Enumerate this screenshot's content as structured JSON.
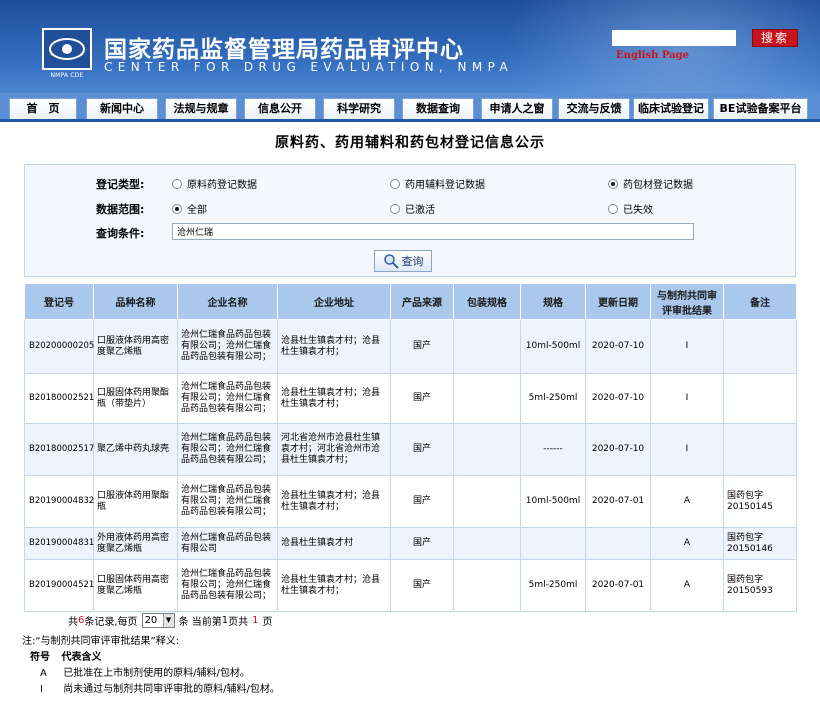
{
  "header": {
    "logo_caption": "NMPA CDE",
    "title_cn": "国家药品监督管理局药品审评中心",
    "title_en": "CENTER FOR DRUG EVALUATION, NMPA",
    "search_value": "",
    "search_button": "搜索",
    "english_link": "English Page"
  },
  "nav": {
    "items": [
      {
        "label": "首　页"
      },
      {
        "label": "新闻中心"
      },
      {
        "label": "法规与规章"
      },
      {
        "label": "信息公开"
      },
      {
        "label": "科学研究"
      },
      {
        "label": "数据查询"
      },
      {
        "label": "申请人之窗"
      },
      {
        "label": "交流与反馈"
      },
      {
        "label": "临床试验登记"
      },
      {
        "label": "BE试验备案平台"
      }
    ]
  },
  "page": {
    "title": "原料药、药用辅料和药包材登记信息公示"
  },
  "form": {
    "type_label": "登记类型:",
    "type_options": [
      {
        "label": "原料药登记数据",
        "selected": false
      },
      {
        "label": "药用辅料登记数据",
        "selected": false
      },
      {
        "label": "药包材登记数据",
        "selected": true
      }
    ],
    "scope_label": "数据范围:",
    "scope_options": [
      {
        "label": "全部",
        "selected": true
      },
      {
        "label": "已激活",
        "selected": false
      },
      {
        "label": "已失效",
        "selected": false
      }
    ],
    "condition_label": "查询条件:",
    "condition_value": "沧州仁瑞",
    "query_button": "查询"
  },
  "table": {
    "headers": [
      "登记号",
      "品种名称",
      "企业名称",
      "企业地址",
      "产品来源",
      "包装规格",
      "规格",
      "更新日期",
      "与制剂共同审评审批结果",
      "备注"
    ],
    "rows": [
      {
        "reg": "B20200000205",
        "name": "口服液体药用高密度聚乙烯瓶",
        "company": "沧州仁瑞食品药品包装有限公司；沧州仁瑞食品药品包装有限公司；",
        "address": "沧县杜生镇袁才村；沧县杜生镇袁才村；",
        "source": "国产",
        "pack": "",
        "spec": "10ml-500ml",
        "date": "2020-07-10",
        "result": "I",
        "note": ""
      },
      {
        "reg": "B20180002521",
        "name": "口服固体药用聚酯瓶（带垫片）",
        "company": "沧州仁瑞食品药品包装有限公司；沧州仁瑞食品药品包装有限公司；",
        "address": "沧县杜生镇袁才村；沧县杜生镇袁才村；",
        "source": "国产",
        "pack": "",
        "spec": "5ml-250ml",
        "date": "2020-07-10",
        "result": "I",
        "note": ""
      },
      {
        "reg": "B20180002517",
        "name": "聚乙烯中药丸球壳",
        "company": "沧州仁瑞食品药品包装有限公司；沧州仁瑞食品药品包装有限公司；",
        "address": "河北省沧州市沧县杜生镇袁才村；河北省沧州市沧县杜生镇袁才村；",
        "source": "国产",
        "pack": "",
        "spec": "------",
        "date": "2020-07-10",
        "result": "I",
        "note": ""
      },
      {
        "reg": "B20190004832",
        "name": "口服液体药用聚酯瓶",
        "company": "沧州仁瑞食品药品包装有限公司；沧州仁瑞食品药品包装有限公司；",
        "address": "沧县杜生镇袁才村；沧县杜生镇袁才村；",
        "source": "国产",
        "pack": "",
        "spec": "10ml-500ml",
        "date": "2020-07-01",
        "result": "A",
        "note": "国药包字20150145"
      },
      {
        "reg": "B20190004831",
        "name": "外用液体药用高密度聚乙烯瓶",
        "company": "沧州仁瑞食品药品包装有限公司",
        "address": "沧县杜生镇袁才村",
        "source": "国产",
        "pack": "",
        "spec": "",
        "date": "",
        "result": "A",
        "note": "国药包字20150146"
      },
      {
        "reg": "B20190004521",
        "name": "口服固体药用高密度聚乙烯瓶",
        "company": "沧州仁瑞食品药品包装有限公司；沧州仁瑞食品药品包装有限公司；",
        "address": "沧县杜生镇袁才村；沧县杜生镇袁才村；",
        "source": "国产",
        "pack": "",
        "spec": "5ml-250ml",
        "date": "2020-07-01",
        "result": "A",
        "note": "国药包字20150593"
      }
    ]
  },
  "pager": {
    "prefix": "共",
    "total": "6",
    "mid1": "条记录,每页",
    "page_size": "20",
    "mid2": "条 当前第",
    "current": "1",
    "mid3": "页共",
    "pages": "1",
    "suffix": "页"
  },
  "notes": {
    "intro": "注:“与制剂共同审评审批结果”释义:",
    "col1": "符号",
    "col2": "代表含义",
    "rows": [
      {
        "symbol": "A",
        "meaning": "已批准在上市制剂使用的原料/辅料/包材。"
      },
      {
        "symbol": "I",
        "meaning": "尚未通过与制剂共同审评审批的原料/辅料/包材。"
      }
    ]
  }
}
